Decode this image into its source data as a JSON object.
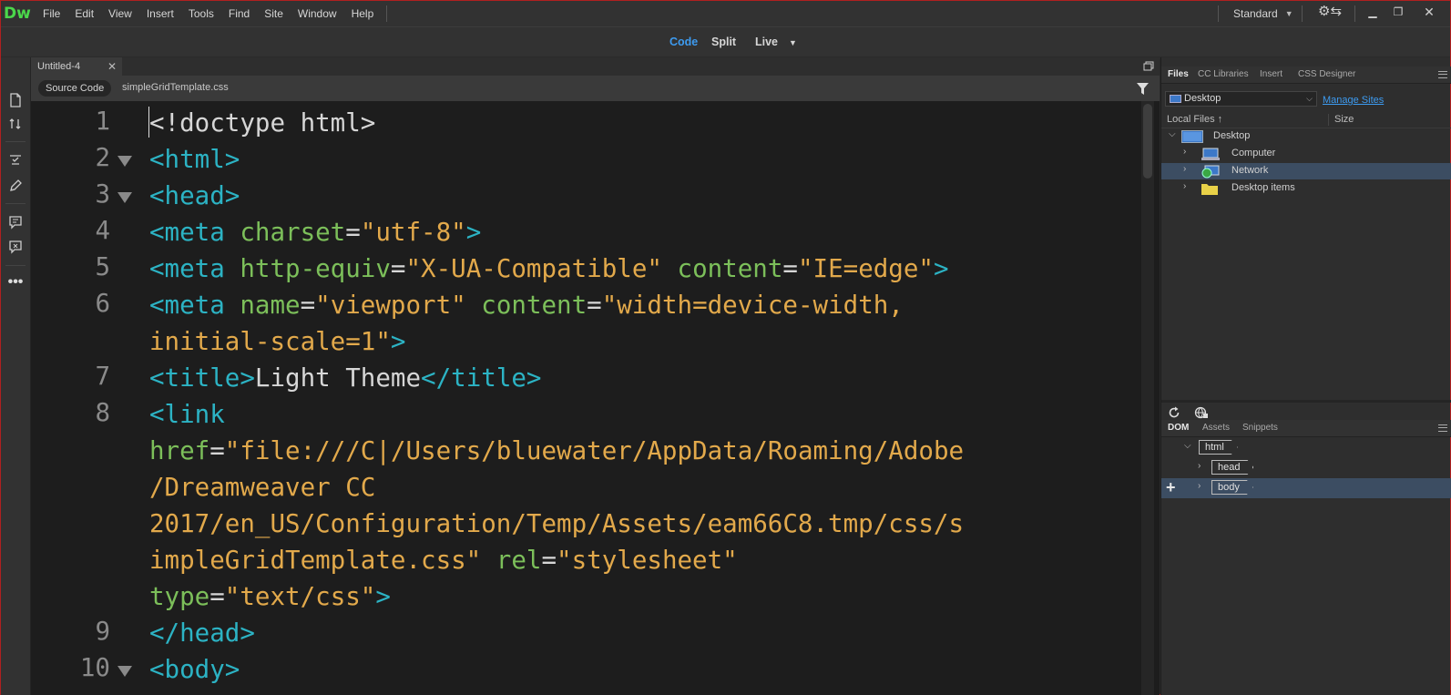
{
  "app": {
    "logo": "Dw",
    "menus": [
      "File",
      "Edit",
      "View",
      "Insert",
      "Tools",
      "Find",
      "Site",
      "Window",
      "Help"
    ],
    "workspace": "Standard"
  },
  "view_switcher": {
    "code": "Code",
    "split": "Split",
    "live": "Live"
  },
  "document": {
    "tab_title": "Untitled-4",
    "source_button": "Source Code",
    "related_file": "simpleGridTemplate.css"
  },
  "code_lines": [
    {
      "n": "1",
      "fold": false
    },
    {
      "n": "2",
      "fold": true
    },
    {
      "n": "3",
      "fold": true
    },
    {
      "n": "4",
      "fold": false
    },
    {
      "n": "5",
      "fold": false
    },
    {
      "n": "6",
      "fold": false
    },
    {
      "n": "7",
      "fold": false
    },
    {
      "n": "8",
      "fold": false
    },
    {
      "n": "9",
      "fold": false
    },
    {
      "n": "10",
      "fold": true
    }
  ],
  "code": {
    "l1": "<!doctype html>",
    "l2": "<html>",
    "l3": "<head>",
    "l4_tag": "<meta ",
    "l4_attr": "charset",
    "l4_eq": "=",
    "l4_val": "\"utf-8\"",
    "l4_end": ">",
    "l5_tag": "<meta ",
    "l5_attr1": "http-equiv",
    "l5_eq1": "=",
    "l5_val1": "\"X-UA-Compatible\"",
    "l5_attr2": " content",
    "l5_eq2": "=",
    "l5_val2": "\"IE=edge\"",
    "l5_end": ">",
    "l6_tag": "<meta ",
    "l6_attr1": "name",
    "l6_eq1": "=",
    "l6_val1": "\"viewport\"",
    "l6_attr2": " content",
    "l6_eq2": "=",
    "l6_val2a": "\"width=device-width,",
    "l6_val2b": "initial-scale=1\"",
    "l6_end": ">",
    "l7_open": "<title>",
    "l7_text": "Light Theme",
    "l7_close": "</title>",
    "l8_tag": "<link",
    "l8_attr1": "href",
    "l8_eq1": "=",
    "l8_val1a": "\"file:///C|/Users/bluewater/AppData/Roaming/Adobe",
    "l8_val1b": "/Dreamweaver CC",
    "l8_val1c": "2017/en_US/Configuration/Temp/Assets/eam66C8.tmp/css/s",
    "l8_val1d": "impleGridTemplate.css\"",
    "l8_attr2": " rel",
    "l8_eq2": "=",
    "l8_val2": "\"stylesheet\"",
    "l8_attr3": "type",
    "l8_eq3": "=",
    "l8_val3": "\"text/css\"",
    "l8_end": ">",
    "l9": "</head>",
    "l10": "<body>"
  },
  "files_panel": {
    "tabs": [
      "Files",
      "CC Libraries",
      "Insert",
      "CSS Designer"
    ],
    "site": "Desktop",
    "manage_sites": "Manage Sites",
    "col_local": "Local Files",
    "col_local_sort": "↑",
    "col_size": "Size",
    "tree": [
      {
        "label": "Desktop",
        "icon": "desktop-icon",
        "expanded": true
      },
      {
        "label": "Computer",
        "icon": "computer-icon",
        "expanded": false
      },
      {
        "label": "Network",
        "icon": "network-icon",
        "expanded": false,
        "selected": true
      },
      {
        "label": "Desktop items",
        "icon": "folder-icon",
        "expanded": false
      }
    ]
  },
  "dom_panel": {
    "tabs": [
      "DOM",
      "Assets",
      "Snippets"
    ],
    "nodes": [
      {
        "tag": "html",
        "expanded": true
      },
      {
        "tag": "head",
        "expanded": false
      },
      {
        "tag": "body",
        "expanded": false,
        "selected": true
      }
    ]
  },
  "colors": {
    "accent_blue": "#3d9bf0",
    "logo_green": "#4bd74b",
    "tag": "#2cb3c4",
    "attr": "#7cbf5a",
    "value": "#e2a94b",
    "selection": "#3c4d62"
  }
}
